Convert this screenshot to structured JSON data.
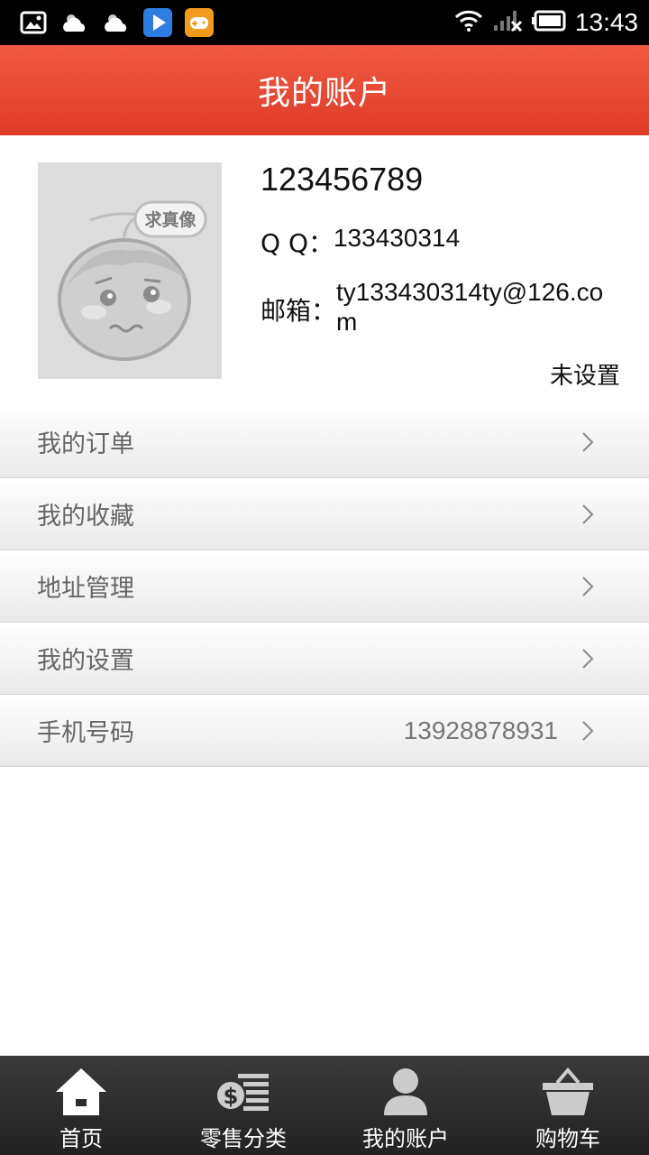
{
  "status_bar": {
    "time": "13:43",
    "icons": [
      "image-icon",
      "cloud-icon",
      "cloud-icon",
      "play-store-icon",
      "game-icon",
      "wifi-icon",
      "signal-icon",
      "battery-icon"
    ]
  },
  "header": {
    "title": "我的账户"
  },
  "profile": {
    "avatar_text": "求真像",
    "user_id": "123456789",
    "qq_label": "Q Q：",
    "qq_value": "133430314",
    "email_label": "邮箱：",
    "email_value": "ty133430314ty@126.com",
    "unset_link": "未设置"
  },
  "menu": [
    {
      "label": "我的订单",
      "value": ""
    },
    {
      "label": "我的收藏",
      "value": ""
    },
    {
      "label": "地址管理",
      "value": ""
    },
    {
      "label": "我的设置",
      "value": ""
    },
    {
      "label": "手机号码",
      "value": "13928878931"
    }
  ],
  "bottom_nav": [
    {
      "label": "首页",
      "icon": "home-icon"
    },
    {
      "label": "零售分类",
      "icon": "retail-category-icon"
    },
    {
      "label": "我的账户",
      "icon": "account-icon"
    },
    {
      "label": "购物车",
      "icon": "basket-icon"
    }
  ],
  "colors": {
    "header_top": "#f05a43",
    "header_bottom": "#de3b28",
    "nav_bg": "#2c2c2c",
    "menu_text": "#666666"
  }
}
